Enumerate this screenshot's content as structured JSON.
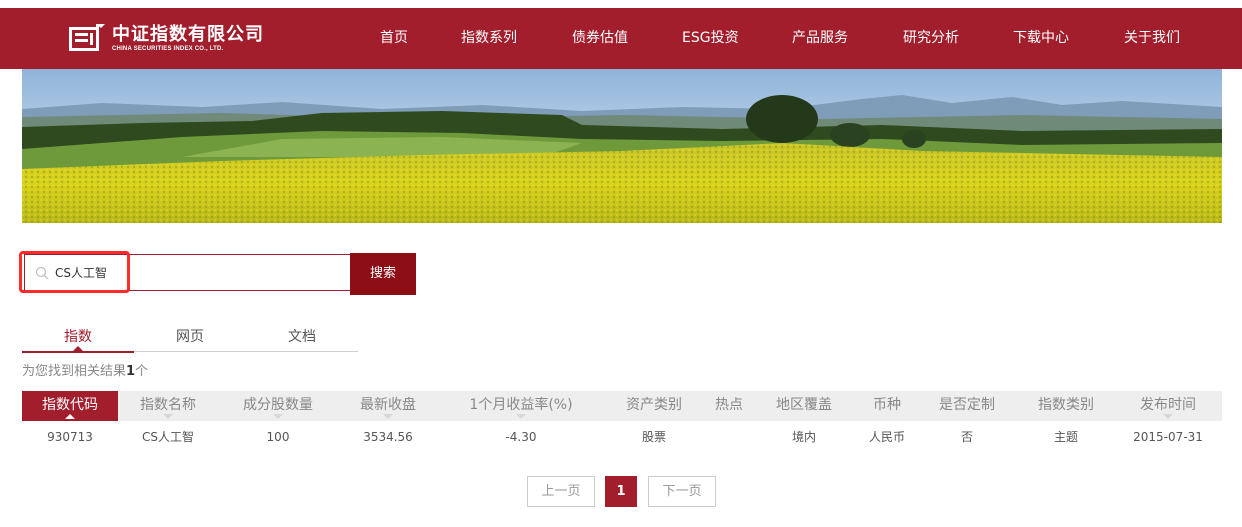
{
  "header": {
    "logo_cn": "中证指数有限公司",
    "logo_en": "CHINA SECURITIES INDEX CO., LTD.",
    "nav": [
      "首页",
      "指数系列",
      "债券估值",
      "ESG投资",
      "产品服务",
      "研究分析",
      "下载中心",
      "关于我们"
    ]
  },
  "search": {
    "value": "CS人工智",
    "button_label": "搜索"
  },
  "tabs": [
    "指数",
    "网页",
    "文档"
  ],
  "active_tab": "指数",
  "result": {
    "prefix": "为您找到相关结果",
    "count": "1",
    "suffix": "个"
  },
  "table": {
    "columns": [
      "指数代码",
      "指数名称",
      "成分股数量",
      "最新收盘",
      "1个月收益率(%)",
      "资产类别",
      "热点",
      "地区覆盖",
      "币种",
      "是否定制",
      "指数类别",
      "发布时间"
    ],
    "rows": [
      [
        "930713",
        "CS人工智",
        "100",
        "3534.56",
        "-4.30",
        "股票",
        "",
        "境内",
        "人民币",
        "否",
        "主题",
        "2015-07-31"
      ]
    ]
  },
  "pagination": {
    "prev_label": "上一页",
    "current_page": "1",
    "next_label": "下一页"
  },
  "colors": {
    "brand": "#a21e2c",
    "search_button": "#8e0e16",
    "highlight": "#ff2a2a"
  }
}
